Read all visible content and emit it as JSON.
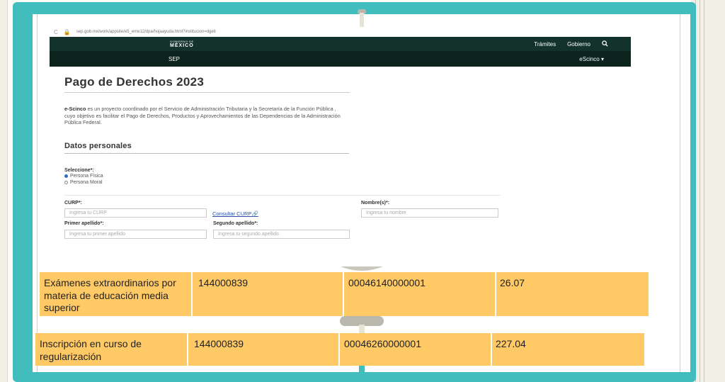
{
  "browser": {
    "url": "sep.gob.mx/work/appsite/e5_eme12/dpa/hojaayuda.html?institucion=dgeti"
  },
  "gov_header": {
    "logo_small": "GOBIERNO DE",
    "logo_big": "MÉXICO",
    "links": [
      "Trámites",
      "Gobierno"
    ]
  },
  "sep_header": {
    "brand": "SEP",
    "menu": "eScinco ▾"
  },
  "page": {
    "title": "Pago de Derechos 2023",
    "intro_bold": "e-Scinco",
    "intro_text": " es un proyecto coordinado por el Servicio de Administración Tributaria y la Secretaría de la Función Pública , cuyo objetivo es facilitar el Pago de Derechos, Productos y Aprovechamientos de las Dependencias de la Administración Pública Federal.",
    "section_title": "Datos personales",
    "select_label": "Seleccione*:",
    "radio_options": [
      "Persona Física",
      "Persona Moral"
    ],
    "selected_option": "Persona Física",
    "curp_label": "CURP*:",
    "curp_placeholder": "Ingresa tu CURP",
    "consult_curp": "Consultar CURP",
    "name_label": "Nombre(s)*:",
    "name_placeholder": "Ingresa tu nombre",
    "first_surname_label": "Primer apellido*:",
    "first_surname_placeholder": "Ingresa tu primer apellido",
    "second_surname_label": "Segundo apellido*:",
    "second_surname_placeholder": "Ingresa tu segundo apellido"
  },
  "table_rows": [
    {
      "concept": "Exámenes extraordinarios por materia de educación media superior",
      "key": "144000839",
      "reference": "00046140000001",
      "amount": "26.07"
    },
    {
      "concept": "Inscripción en curso de regularización",
      "key": "144000839",
      "reference": "00046260000001",
      "amount": "227.04"
    }
  ],
  "colors": {
    "teal_frame": "#41bdbd",
    "gov_green": "#13322b",
    "row_yellow": "#ffc966",
    "link_blue": "#2b4fa2"
  }
}
